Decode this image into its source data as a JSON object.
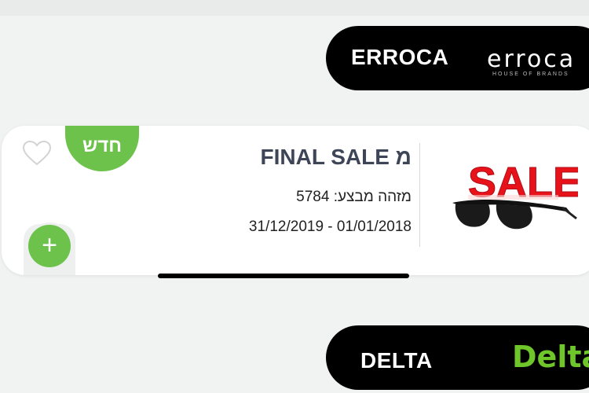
{
  "brands": [
    {
      "name": "ERROCA",
      "logo_text": "erroca",
      "logo_subtext": "HOUSE OF BRANDS"
    },
    {
      "name": "DELTA",
      "logo_text": "Delta"
    }
  ],
  "deal": {
    "title": "מ FINAL SALE",
    "badge": "חדש",
    "deal_id_line": "מזהה מבצע: 5784",
    "date_range": "31/12/2019 - 01/01/2018",
    "image_text": "SALE",
    "plus_label": "+"
  },
  "colors": {
    "accent_green": "#6cc24a",
    "pill_black": "#000000",
    "title_navy": "#3d4556",
    "delta_green": "#6fc62b",
    "sale_red": "#e8121b"
  },
  "icons": {
    "favorite": "heart-outline-icon",
    "add": "plus-icon"
  }
}
